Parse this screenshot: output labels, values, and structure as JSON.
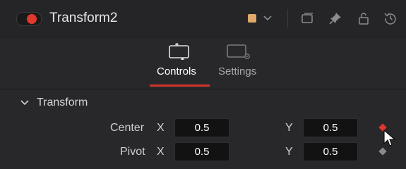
{
  "header": {
    "title": "Transform2",
    "toggle_on": true,
    "color_swatch": "#e0a869",
    "icons": [
      "chevron-down-icon",
      "window-icon",
      "pin-icon",
      "lock-icon",
      "reset-icon"
    ]
  },
  "tabs": [
    {
      "label": "Controls",
      "icon": "controls-icon",
      "active": true
    },
    {
      "label": "Settings",
      "icon": "settings-icon",
      "active": false
    }
  ],
  "section": {
    "title": "Transform",
    "expanded": true
  },
  "rows": [
    {
      "label": "Center",
      "x_label": "X",
      "x_value": "0.5",
      "y_label": "Y",
      "y_value": "0.5",
      "keyframe_color": "#e2372d"
    },
    {
      "label": "Pivot",
      "x_label": "X",
      "x_value": "0.5",
      "y_label": "Y",
      "y_value": "0.5",
      "keyframe_color": "#8a8a8a"
    }
  ],
  "colors": {
    "accent": "#d0342c",
    "record_dot": "#e2372d"
  }
}
